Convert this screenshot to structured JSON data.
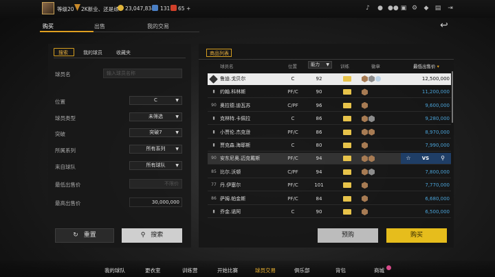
{
  "topbar": {
    "level": "等级20",
    "rank": "2K新业、还是顽",
    "coins": "23,047,834",
    "tickets": "131",
    "points": "65",
    "plus": "+",
    "icons": [
      "bell-icon",
      "user-icon",
      "group-icon",
      "message-icon",
      "chat-icon",
      "gear-icon",
      "shield-icon",
      "exit-icon"
    ]
  },
  "main_tabs": [
    "购买",
    "出售",
    "我的交易"
  ],
  "left_panel": {
    "tabs": [
      "搜索",
      "我的球员",
      "收藏夹"
    ],
    "fields": {
      "player_name": {
        "label": "球员名",
        "placeholder": "输入球员名称"
      },
      "position": {
        "label": "位置",
        "value": "C"
      },
      "player_type": {
        "label": "球员类型",
        "value": "未筛选"
      },
      "breakthrough": {
        "label": "突破",
        "value": "突破7"
      },
      "series": {
        "label": "所属系列",
        "value": "所有系列"
      },
      "team": {
        "label": "来自球队",
        "value": "所有球队"
      },
      "min_price": {
        "label": "最低出售价",
        "placeholder": "不限价"
      },
      "max_price": {
        "label": "最高出售价",
        "value": "30,000,000"
      }
    },
    "reset_label": "重置",
    "search_label": "搜索"
  },
  "right_panel": {
    "tab": "商品列表",
    "headers": {
      "name": "球员名",
      "position": "位置",
      "sort": "能力",
      "train": "训练",
      "badges": "徽章",
      "price": "最低出售价"
    },
    "rows": [
      {
        "ovr": "",
        "name": "鲁迪.戈贝尔",
        "pos": "C",
        "val": "92",
        "price": "12,500,000",
        "badges": [
          "b",
          "s",
          "c"
        ]
      },
      {
        "ovr": "",
        "name": "约翰.科林斯",
        "pos": "PF/C",
        "val": "90",
        "price": "11,200,000",
        "badges": [
          "b"
        ]
      },
      {
        "ovr": "90",
        "name": "奥拉德.迪瓦苏",
        "pos": "C/PF",
        "val": "96",
        "price": "9,600,000",
        "badges": [
          "b"
        ]
      },
      {
        "ovr": "",
        "name": "克林特.卡佩拉",
        "pos": "C",
        "val": "86",
        "price": "9,280,000",
        "badges": [
          "b",
          "s"
        ]
      },
      {
        "ovr": "",
        "name": "小贾伦.杰克逊",
        "pos": "PF/C",
        "val": "86",
        "price": "8,970,000",
        "badges": [
          "b",
          "b"
        ]
      },
      {
        "ovr": "",
        "name": "贾克森.海耶斯",
        "pos": "C",
        "val": "80",
        "price": "7,990,000",
        "badges": [
          "b"
        ]
      },
      {
        "ovr": "90",
        "name": "安东尼奥.迈克戴斯",
        "pos": "PF/C",
        "val": "94",
        "price": "",
        "badges": [
          "b",
          "b"
        ]
      },
      {
        "ovr": "85",
        "name": "比尔.沃顿",
        "pos": "C/PF",
        "val": "94",
        "price": "7,800,000",
        "badges": [
          "b",
          "s"
        ]
      },
      {
        "ovr": "77",
        "name": "丹.伊塞尔",
        "pos": "PF/C",
        "val": "101",
        "price": "7,770,000",
        "badges": [
          "b"
        ]
      },
      {
        "ovr": "86",
        "name": "萨姆.帕金斯",
        "pos": "PF/C",
        "val": "84",
        "price": "6,680,000",
        "badges": [
          "b"
        ]
      },
      {
        "ovr": "",
        "name": "乔金.诺阿",
        "pos": "C",
        "val": "90",
        "price": "6,500,000",
        "badges": [
          "b"
        ]
      }
    ],
    "vs_label": "VS",
    "reserve_label": "预购",
    "buy_label": "购买"
  },
  "bottom_nav": [
    "我的球队",
    "更衣室",
    "训练营",
    "开始比赛",
    "球员交易",
    "俱乐部",
    "背包",
    "商城"
  ],
  "colors": {
    "accent": "#e6bd1c",
    "price": "#4aa3d8",
    "compare": "#1f3e66"
  }
}
